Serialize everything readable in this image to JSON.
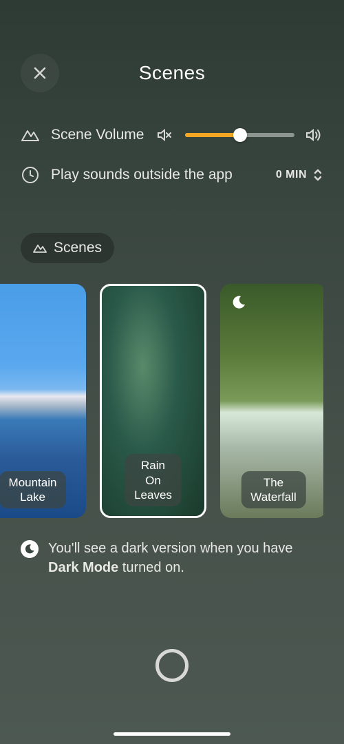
{
  "header": {
    "title": "Scenes"
  },
  "settings": {
    "volume_label": "Scene Volume",
    "volume_percent": 50,
    "play_outside_label": "Play sounds outside the app",
    "duration_value": "0 MIN"
  },
  "tab": {
    "label": "Scenes"
  },
  "scenes": [
    {
      "title": "Mountain\nLake",
      "selected": false,
      "dark_available": false,
      "bg": "scene-mountain"
    },
    {
      "title": "Rain On\nLeaves",
      "selected": true,
      "dark_available": false,
      "bg": "scene-rain"
    },
    {
      "title": "The Waterfall",
      "selected": false,
      "dark_available": true,
      "bg": "scene-waterfall"
    }
  ],
  "hint": {
    "prefix": "You'll see a dark version when you have ",
    "bold": "Dark Mode",
    "suffix": " turned on."
  },
  "colors": {
    "accent": "#f5a623"
  }
}
